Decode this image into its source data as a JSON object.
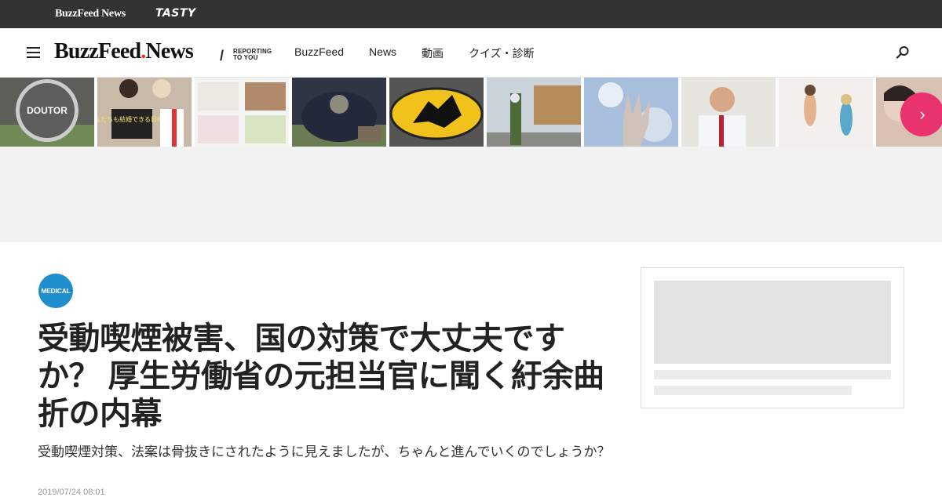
{
  "brandbar": {
    "buzzfeed_news": "BuzzFeed News",
    "tasty": "TASTY"
  },
  "header": {
    "logo_main": "BuzzFeed",
    "logo_news": "News",
    "slash": "/",
    "tagline_line1": "REPORTING",
    "tagline_line2": "TO YOU",
    "nav": [
      "BuzzFeed",
      "News",
      "動画",
      "クイズ・診断"
    ]
  },
  "strip": {
    "thumbnails": [
      {
        "icon": "doutor-cafe-photo",
        "sign_text": "DOUTOR"
      },
      {
        "icon": "people-with-sign-photo",
        "sign_text": "私たちも結婚できる日本へ"
      },
      {
        "icon": "bags-of-powder-photo"
      },
      {
        "icon": "cat-in-bag-photo"
      },
      {
        "icon": "black-cat-sign-photo"
      },
      {
        "icon": "flowers-building-photo"
      },
      {
        "icon": "hand-sky-photo"
      },
      {
        "icon": "man-in-shirt-photo"
      },
      {
        "icon": "figurines-photo"
      },
      {
        "icon": "person-portrait-photo"
      }
    ],
    "next_arrow": "›"
  },
  "article": {
    "category": "MEDICAL",
    "headline": "受動喫煙被害、国の対策で大丈夫ですか？ 厚生労働省の元担当官に聞く紆余曲折の内幕",
    "dek": "受動喫煙対策、法案は骨抜きにされたように見えましたが、ちゃんと進んでいくのでしょうか？",
    "date": "2019/07/24 08:01"
  },
  "colors": {
    "accent_pink": "#e8336e",
    "badge_blue": "#1f8ecd",
    "topbar": "#333333"
  }
}
